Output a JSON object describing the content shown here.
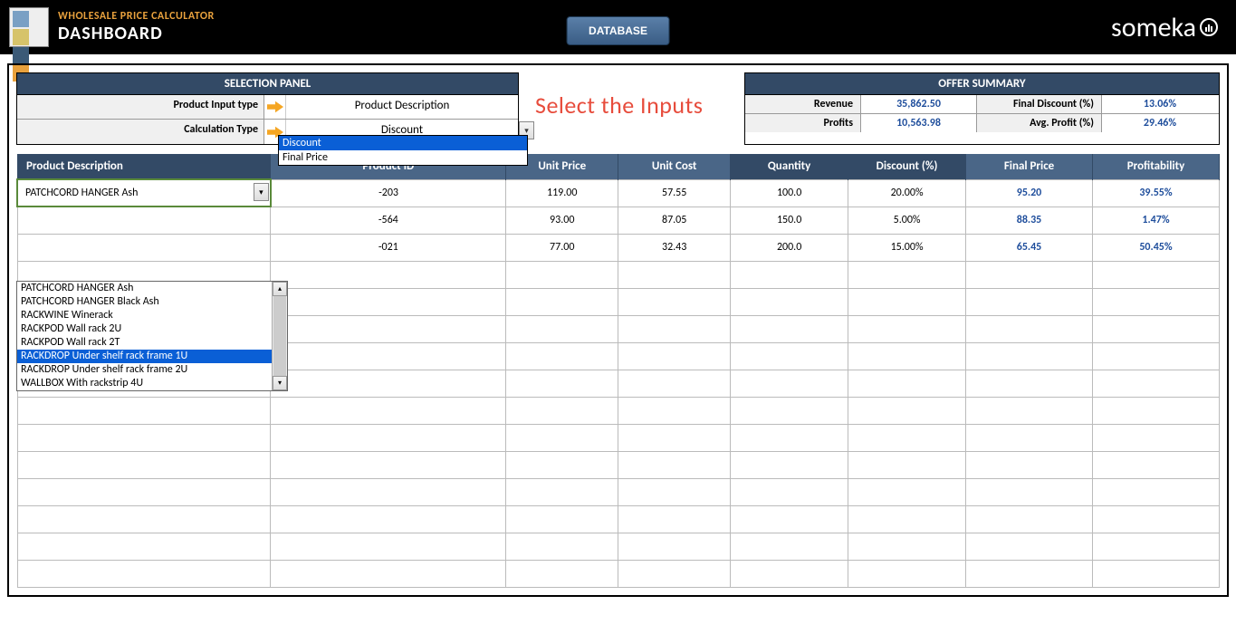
{
  "header": {
    "small": "WHOLESALE PRICE CALCULATOR",
    "big": "DASHBOARD",
    "db_button": "DATABASE",
    "brand": "someka"
  },
  "selection": {
    "head": "SELECTION PANEL",
    "row1_label": "Product Input type",
    "row1_value": "Product Description",
    "row2_label": "Calculation Type",
    "row2_value": "Discount"
  },
  "calc_dropdown": [
    "Discount",
    "Final Price"
  ],
  "hint": "Select the Inputs",
  "summary": {
    "head": "OFFER SUMMARY",
    "revenue_lbl": "Revenue",
    "revenue_val": "35,862.50",
    "finaldisc_lbl": "Final Discount (%)",
    "finaldisc_val": "13.06%",
    "profits_lbl": "Profits",
    "profits_val": "10,563.98",
    "avgprof_lbl": "Avg. Profit (%)",
    "avgprof_val": "29.46%"
  },
  "columns": {
    "c0": "Product Description",
    "c1": "Product ID",
    "c2": "Unit Price",
    "c3": "Unit Cost",
    "c4": "Quantity",
    "c5": "Discount (%)",
    "c6": "Final Price",
    "c7": "Profitability"
  },
  "rows": [
    {
      "desc": "PATCHCORD HANGER Ash",
      "pid": "-203",
      "up": "119.00",
      "uc": "57.55",
      "qty": "100.0",
      "disc": "20.00%",
      "fp": "95.20",
      "prof": "39.55%"
    },
    {
      "desc": "",
      "pid": "-564",
      "up": "93.00",
      "uc": "87.05",
      "qty": "150.0",
      "disc": "5.00%",
      "fp": "88.35",
      "prof": "1.47%"
    },
    {
      "desc": "",
      "pid": "-021",
      "up": "77.00",
      "uc": "32.43",
      "qty": "200.0",
      "disc": "15.00%",
      "fp": "65.45",
      "prof": "50.45%"
    }
  ],
  "product_dropdown": [
    "PATCHCORD HANGER Ash",
    "PATCHCORD HANGER Black Ash",
    "RACKWINE Winerack",
    "RACKPOD Wall rack 2U",
    "RACKPOD Wall rack 2T",
    "RACKDROP Under shelf rack frame 1U",
    "RACKDROP Under shelf rack frame 2U",
    "WALLBOX With rackstrip 4U"
  ]
}
